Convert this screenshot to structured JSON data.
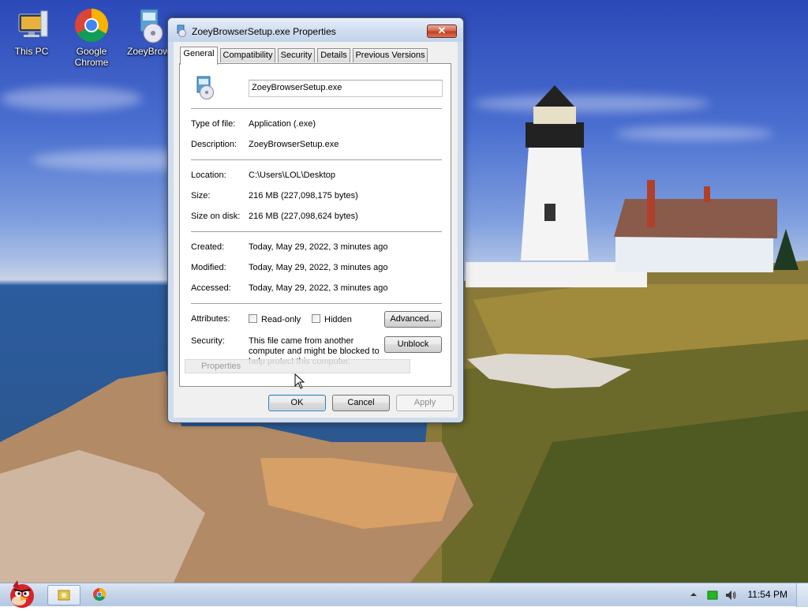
{
  "desktop": {
    "icons": [
      {
        "label": "This PC"
      },
      {
        "label": "Google Chrome"
      },
      {
        "label": "ZoeyBrow"
      }
    ]
  },
  "dialog": {
    "title": "ZoeyBrowserSetup.exe Properties",
    "close_label": "✕",
    "tabs": [
      {
        "label": "General",
        "active": true
      },
      {
        "label": "Compatibility"
      },
      {
        "label": "Security"
      },
      {
        "label": "Details"
      },
      {
        "label": "Previous Versions"
      }
    ],
    "general": {
      "filename": "ZoeyBrowserSetup.exe",
      "type_label": "Type of file:",
      "type_value": "Application (.exe)",
      "description_label": "Description:",
      "description_value": "ZoeyBrowserSetup.exe",
      "location_label": "Location:",
      "location_value": "C:\\Users\\LOL\\Desktop",
      "size_label": "Size:",
      "size_value": "216 MB (227,098,175 bytes)",
      "size_on_disk_label": "Size on disk:",
      "size_on_disk_value": "216 MB (227,098,624 bytes)",
      "created_label": "Created:",
      "created_value": "Today, May 29, 2022, 3 minutes ago",
      "modified_label": "Modified:",
      "modified_value": "Today, May 29, 2022, 3 minutes ago",
      "accessed_label": "Accessed:",
      "accessed_value": "Today, May 29, 2022, 3 minutes ago",
      "attributes_label": "Attributes:",
      "readonly_label": "Read-only",
      "hidden_label": "Hidden",
      "advanced_button": "Advanced...",
      "security_label": "Security:",
      "security_line1": "This file came from another",
      "security_line2": "computer and might be blocked to",
      "security_line3": "help protect this computer.",
      "unblock_button": "Unblock",
      "tooltip": "Properties"
    },
    "buttons": {
      "ok": "OK",
      "cancel": "Cancel",
      "apply": "Apply"
    }
  },
  "taskbar": {
    "clock": "11:54 PM"
  },
  "colors": {
    "dialog_frame": "#cfdcec",
    "close_button": "#c23f1e",
    "tray_indicator": "#22b822"
  }
}
